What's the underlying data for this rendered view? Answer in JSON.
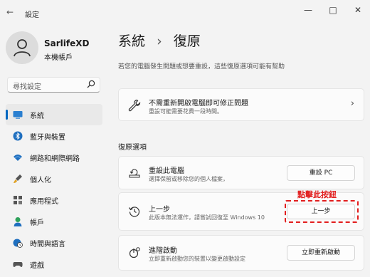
{
  "window": {
    "app_title": "設定",
    "back_icon": "back-arrow-icon",
    "controls": [
      "—",
      "□",
      "✕"
    ]
  },
  "user": {
    "name": "SarlifeXD",
    "account_type": "本機帳戶"
  },
  "search": {
    "placeholder": "尋找設定"
  },
  "sidebar": {
    "items": [
      {
        "label": "系統",
        "icon": "monitor-icon",
        "active": true
      },
      {
        "label": "藍牙與裝置",
        "icon": "bluetooth-icon",
        "active": false
      },
      {
        "label": "網路和網際網路",
        "icon": "wifi-icon",
        "active": false
      },
      {
        "label": "個人化",
        "icon": "brush-icon",
        "active": false
      },
      {
        "label": "應用程式",
        "icon": "apps-icon",
        "active": false
      },
      {
        "label": "帳戶",
        "icon": "account-icon",
        "active": false
      },
      {
        "label": "時間與語言",
        "icon": "globe-clock-icon",
        "active": false
      },
      {
        "label": "遊戲",
        "icon": "gamepad-icon",
        "active": false
      }
    ]
  },
  "header": {
    "breadcrumb_parent": "系統",
    "breadcrumb_separator": "›",
    "breadcrumb_current": "復原",
    "description": "若您的電腦發生問題或想要重設，這些復原選項可能有幫助"
  },
  "troubleshoot_card": {
    "title": "不需重新開啟電腦即可修正問題",
    "subtitle": "重設可能需要花費一段時間。"
  },
  "recovery": {
    "section_title": "復原選項",
    "options": [
      {
        "title": "重設此電腦",
        "subtitle": "選擇保留或移除您的個人檔案，",
        "button": "重設 PC"
      },
      {
        "title": "上一步",
        "subtitle": "此版本無法運作，請嘗試回復至 Windows 10",
        "button": "上一步"
      },
      {
        "title": "進階啟動",
        "subtitle": "立即重新啟動您的裝置以變更啟動設定",
        "button": "立即重新啟動"
      }
    ]
  },
  "annotation": {
    "text": "點擊此按鈕",
    "color": "#e21e1e"
  },
  "colors": {
    "accent": "#0067c0",
    "background": "#f3f3f3"
  }
}
